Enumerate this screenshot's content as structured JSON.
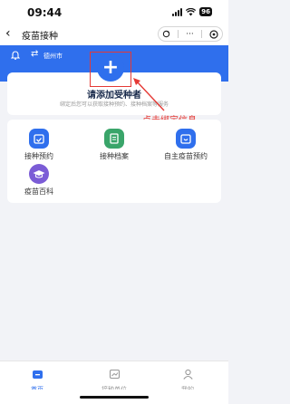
{
  "status_bar": {
    "time": "09:44",
    "battery": "96"
  },
  "navbar": {
    "back_icon": "‹",
    "title": "疫苗接种",
    "capsule_more": "···"
  },
  "header": {
    "city": "德州市"
  },
  "add_card": {
    "title": "请添加受种者",
    "subtitle": "绑定后您可以获取接种预约、接种档案等服务"
  },
  "annotation": {
    "text": "点击绑定信息",
    "color": "#e53935"
  },
  "services": [
    {
      "label": "接种预约",
      "color": "#2f6fed",
      "icon": "calendar-icon"
    },
    {
      "label": "接种档案",
      "color": "#3aa56a",
      "icon": "file-icon"
    },
    {
      "label": "自主疫苗预约",
      "color": "#2f6fed",
      "icon": "calendar-check-icon"
    },
    {
      "label": "疫苗百科",
      "color": "#7b5cd6",
      "icon": "graduation-cap-icon"
    }
  ],
  "tabs": [
    {
      "label": "首页",
      "active": true
    },
    {
      "label": "接种单位",
      "active": false
    },
    {
      "label": "我的",
      "active": false
    }
  ],
  "colors": {
    "primary": "#2f6fed",
    "annotation": "#e53935"
  }
}
